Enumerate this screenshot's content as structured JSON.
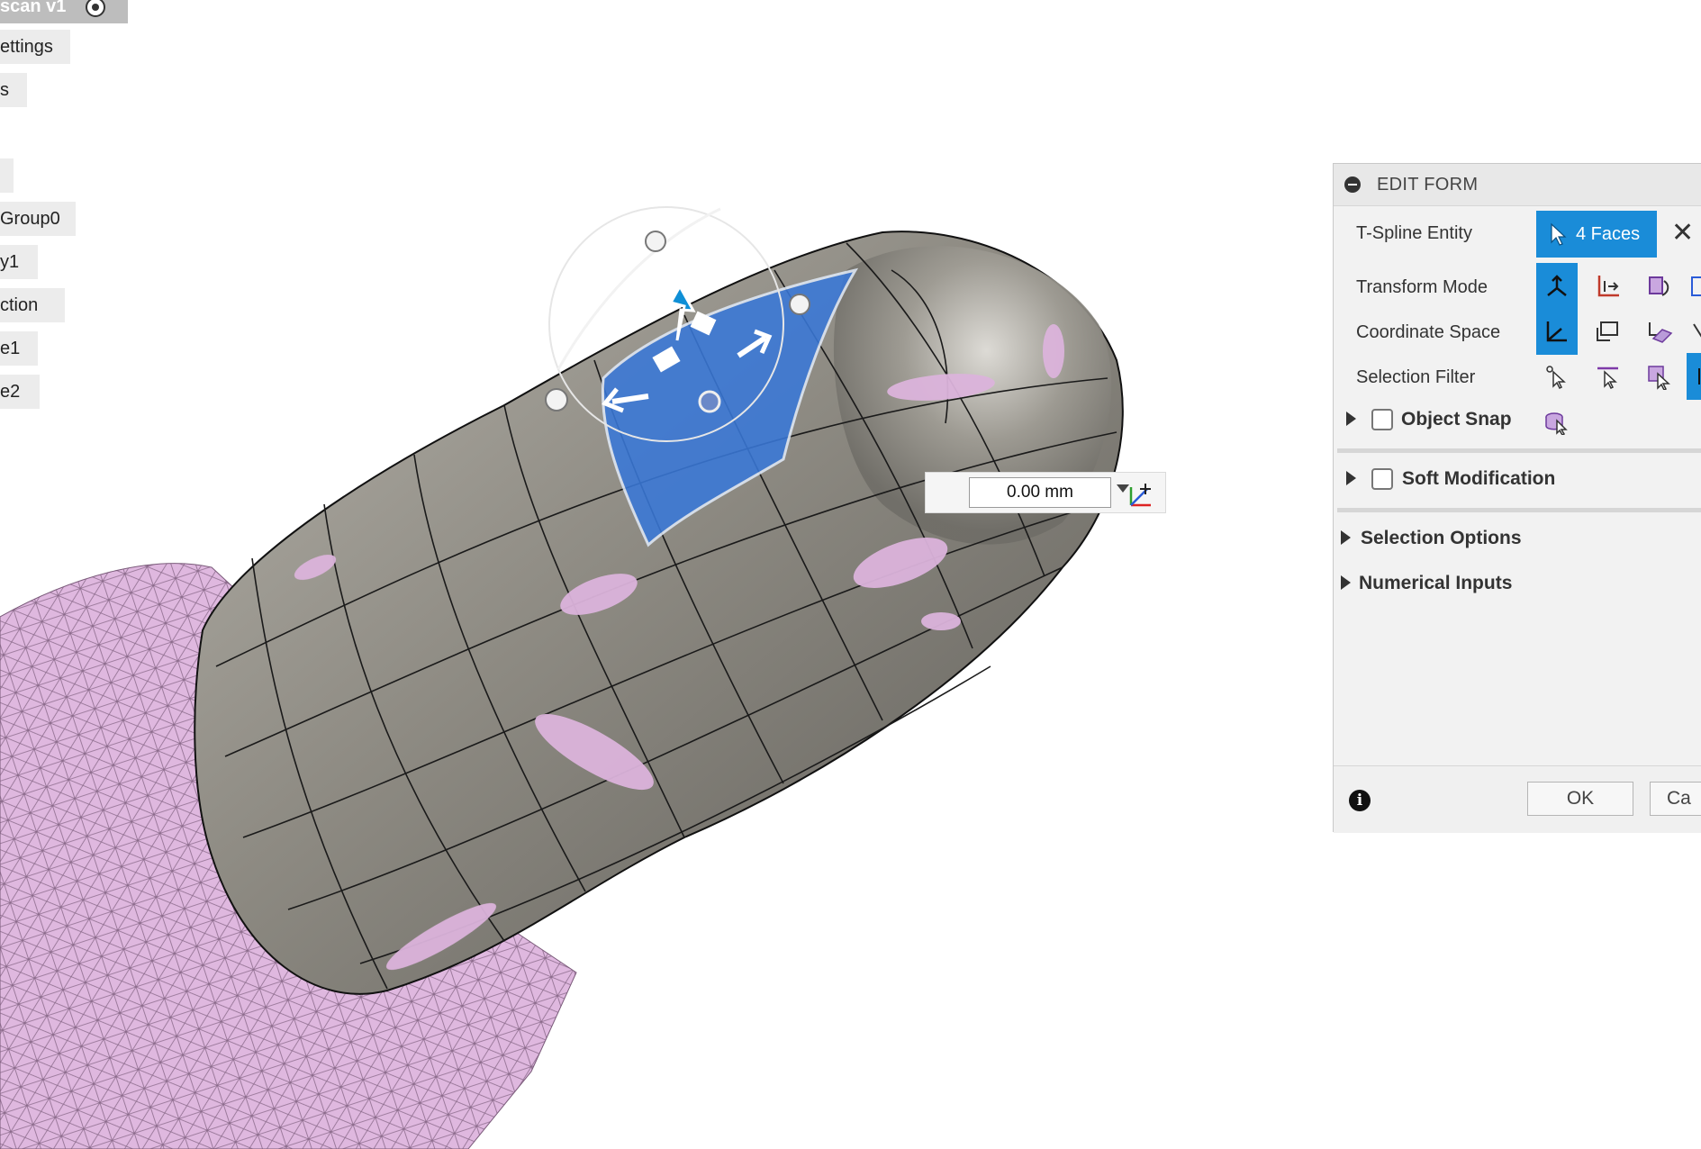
{
  "browser": {
    "items": [
      {
        "label": "scan v1",
        "top": 0
      },
      {
        "label": "ettings"
      },
      {
        "label": "s"
      },
      {
        "label": "Group0"
      },
      {
        "label": "y1"
      },
      {
        "label": "ction"
      },
      {
        "label": "e1"
      },
      {
        "label": "e2"
      }
    ]
  },
  "dimension": {
    "value": "0.00 mm"
  },
  "panel": {
    "title": "EDIT FORM",
    "tspline_entity_label": "T-Spline Entity",
    "entity_value": "4 Faces",
    "transform_mode_label": "Transform Mode",
    "coordinate_space_label": "Coordinate Space",
    "selection_filter_label": "Selection Filter",
    "object_snap_label": "Object Snap",
    "soft_modification_label": "Soft Modification",
    "selection_options_label": "Selection Options",
    "numerical_inputs_label": "Numerical Inputs",
    "ok_label": "OK",
    "cancel_label": "Ca"
  },
  "colors": {
    "accent": "#1a8cd8",
    "mesh_pink": "#dcb4dc",
    "tspline_gray": "#8f8c84",
    "selected_face": "#3a78d8"
  },
  "icons": [
    "radio-icon",
    "cursor-icon",
    "close-icon",
    "info-icon",
    "triad-icon",
    "dropdown-icon"
  ]
}
